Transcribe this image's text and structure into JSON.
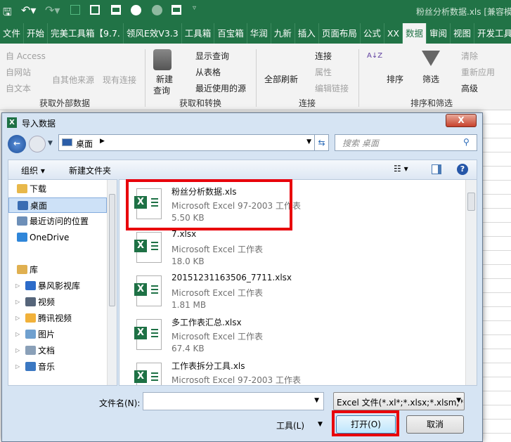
{
  "excel": {
    "window_title": "粉丝分析数据.xls  [兼容模",
    "tabs": [
      "文件",
      "开始",
      "完美工具箱【9.7.",
      "领风E效V3.3",
      "工具箱",
      "百宝箱",
      "华润",
      "九新",
      "插入",
      "页面布局",
      "公式",
      "XX",
      "数据",
      "审阅",
      "视图",
      "开发工具"
    ],
    "active_tab": "数据",
    "ribbon": {
      "from_access": "自 Access",
      "from_web": "自网站",
      "from_text": "自文本",
      "from_other": "自其他来源",
      "existing": "现有连接",
      "group1": "获取外部数据",
      "new_query_1": "新建",
      "new_query_2": "查询",
      "show_queries": "显示查询",
      "from_table": "从表格",
      "recent_sources": "最近使用的源",
      "group2": "获取和转换",
      "refresh_all": "全部刷新",
      "connections": "连接",
      "properties": "属性",
      "edit_links": "编辑链接",
      "group3": "连接",
      "sort": "排序",
      "filter": "筛选",
      "clear": "清除",
      "reapply": "重新应用",
      "advanced": "高级",
      "group4": "排序和筛选"
    }
  },
  "dialog": {
    "title": "导入数据",
    "address": "桌面",
    "search_placeholder": "搜索 桌面",
    "organize": "组织 ▾",
    "new_folder": "新建文件夹",
    "nav": [
      {
        "label": "下载",
        "color": "#e8b84a"
      },
      {
        "label": "桌面",
        "color": "#3a6db3",
        "selected": true
      },
      {
        "label": "最近访问的位置",
        "color": "#6d8fb8"
      },
      {
        "label": "OneDrive",
        "color": "#2f86d9"
      },
      {
        "label": "库",
        "color": "#e0b050"
      },
      {
        "label": "暴风影视库",
        "color": "#2c6bc9"
      },
      {
        "label": "视频",
        "color": "#56657a"
      },
      {
        "label": "腾讯视频",
        "color": "#f1b13a"
      },
      {
        "label": "图片",
        "color": "#6fa0cf"
      },
      {
        "label": "文档",
        "color": "#8aa0b8"
      },
      {
        "label": "音乐",
        "color": "#3b78c2"
      }
    ],
    "files": [
      {
        "name": "粉丝分析数据.xls",
        "type": "Microsoft Excel 97-2003 工作表",
        "size": "5.50 KB"
      },
      {
        "name": "7.xlsx",
        "type": "Microsoft Excel 工作表",
        "size": "18.0 KB"
      },
      {
        "name": "20151231163506_7711.xlsx",
        "type": "Microsoft Excel 工作表",
        "size": "1.81 MB"
      },
      {
        "name": "多工作表汇总.xlsx",
        "type": "Microsoft Excel 工作表",
        "size": "67.4 KB"
      },
      {
        "name": "工作表拆分工具.xls",
        "type": "Microsoft Excel 97-2003 工作表",
        "size": ""
      }
    ],
    "filename_label": "文件名(N):",
    "filename_value": "",
    "filter": "Excel 文件(*.xl*;*.xlsx;*.xlsm;*.",
    "tools": "工具(L)",
    "open": "打开(O)",
    "cancel": "取消",
    "close": "X"
  }
}
